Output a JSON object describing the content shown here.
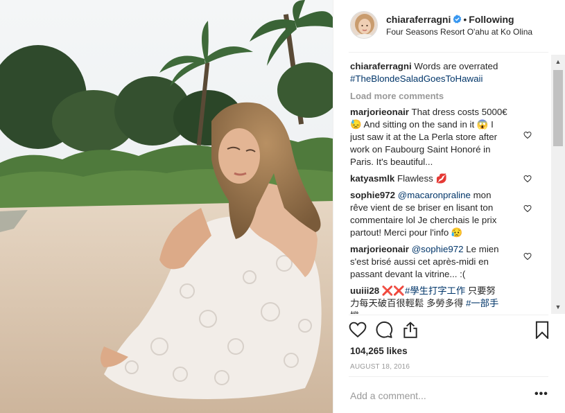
{
  "header": {
    "username": "chiaraferragni",
    "separator": "•",
    "following_label": "Following",
    "location": "Four Seasons Resort O'ahu at Ko Olina"
  },
  "caption": {
    "user": "chiaraferragni",
    "text": "Words are overrated",
    "hashtag": "#TheBlondeSaladGoesToHawaii"
  },
  "load_more_label": "Load more comments",
  "comments": [
    {
      "user": "marjorieonair",
      "lines": [
        "That dress costs 5000€",
        "😓 And sitting on the sand in it 😱 I",
        "just saw it at the La Perla store after",
        "work on Faubourg Saint Honoré in",
        "Paris. It's beautiful..."
      ]
    },
    {
      "user": "katyasmlk",
      "lines": [
        "Flawless 💋"
      ]
    },
    {
      "user": "sophie972",
      "mention": "@macaronpraline",
      "lines": [
        "mon",
        "rêve vient de se briser en lisant ton",
        "commentaire lol Je cherchais le prix",
        "partout! Merci pour l'info 😥"
      ]
    },
    {
      "user": "marjorieonair",
      "mention": "@sophie972",
      "lines": [
        "Le mien",
        "s'est brisé aussi cet après-midi en",
        "passant devant la vitrine... :("
      ]
    },
    {
      "user": "uuiii28",
      "prefix": "❌❌",
      "tag1": "#學生打字工作",
      "text1": "只要努",
      "line2_text": "力每天破百很輕鬆 多勞多得",
      "tag2": "#一部手",
      "line3": "機"
    }
  ],
  "likes": "104,265 likes",
  "date": "AUGUST 18, 2016",
  "add_comment_placeholder": "Add a comment...",
  "more_label": "•••",
  "icons": {
    "verified": "verified-badge-icon",
    "like": "heart-outline-icon",
    "comment": "speech-bubble-icon",
    "share": "share-upload-icon",
    "save": "bookmark-icon",
    "comment_like": "small-heart-icon"
  },
  "colors": {
    "accent": "#3897f0",
    "hashtag": "#003569",
    "muted": "#999999",
    "text": "#262626"
  }
}
